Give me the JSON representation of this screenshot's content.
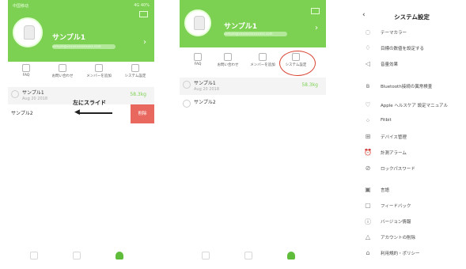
{
  "phone1": {
    "status_left": "中国移动",
    "status_right": "4G 40%",
    "user_name": "サンプル1",
    "user_email": "sample@xxxxxxxxxxxxxx.com",
    "menu": [
      {
        "label": "FAQ"
      },
      {
        "label": "お問い合わせ"
      },
      {
        "label": "メンバーを追加"
      },
      {
        "label": "システム設定"
      }
    ],
    "members": [
      {
        "name": "サンプル1",
        "date": "Aug 20 2018",
        "weight": "58.3kg"
      },
      {
        "name": "サンプル2"
      }
    ],
    "swipe_label": "左にスライド",
    "delete_label": "削除"
  },
  "phone2": {
    "user_name": "サンプル1",
    "user_email": "sample@xxxxxxxxxxxxxx.com",
    "menu": [
      {
        "label": "FAQ"
      },
      {
        "label": "お問い合わせ"
      },
      {
        "label": "メンバーを追加"
      },
      {
        "label": "システム設定"
      }
    ],
    "members": [
      {
        "name": "サンプル1",
        "date": "Aug 20 2018",
        "weight": "58.3kg"
      },
      {
        "name": "サンプル2"
      }
    ]
  },
  "settings": {
    "back_icon": "chevron-left-icon",
    "title": "システム設定",
    "items": [
      {
        "label": "テーマカラー",
        "icon": "palette-icon"
      },
      {
        "label": "目標の数値を設定する",
        "icon": "target-icon"
      },
      {
        "label": "音量効果",
        "icon": "volume-icon"
      },
      {
        "label": "Bluetooth接続の異常検査",
        "icon": "bluetooth-icon"
      },
      {
        "label": "Apple ヘルスケア 設定マニュアル",
        "icon": "heart-icon"
      },
      {
        "label": "Fitbit",
        "icon": "fitbit-icon"
      },
      {
        "label": "デバイス管理",
        "icon": "device-icon"
      },
      {
        "label": "計測アラーム",
        "icon": "alarm-icon"
      },
      {
        "label": "ロックパスワード",
        "icon": "lock-icon"
      },
      {
        "label": "言語",
        "icon": "language-icon"
      },
      {
        "label": "フィードバック",
        "icon": "feedback-icon"
      },
      {
        "label": "バージョン情報",
        "icon": "info-icon"
      },
      {
        "label": "アカウントの削除",
        "icon": "warning-icon"
      },
      {
        "label": "利用規約・ポリシー",
        "icon": "policy-icon"
      }
    ]
  },
  "colors": {
    "accent": "#7cd152",
    "delete": "#e8675f",
    "highlight": "#d9412f"
  }
}
